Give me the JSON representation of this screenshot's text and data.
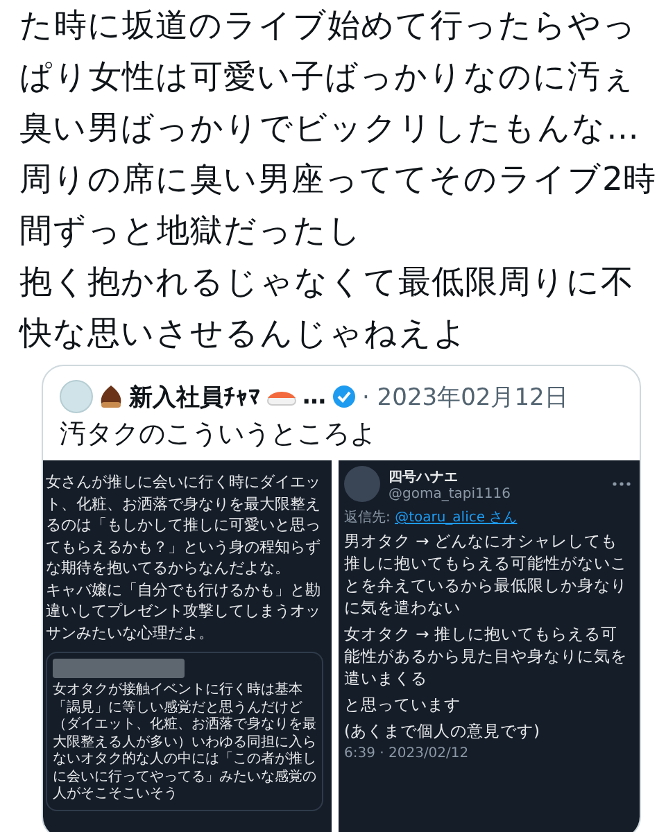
{
  "tweet": {
    "lines": [
      "た時に坂道のライブ始めて行ったらやっ",
      "ぱり女性は可愛い子ばっかりなのに汚ぇ",
      "臭い男ばっかりでビックリしたもんな…",
      "周りの席に臭い男座っててそのライブ2時",
      "間ずっと地獄だったし",
      "抱く抱かれるじゃなくて最低限周りに不",
      "快な思いさせるんじゃねえよ"
    ]
  },
  "quote": {
    "author": {
      "name": "新入社員ﾁｬﾏ",
      "truncation": "…",
      "verified": true
    },
    "date": "· 2023年02月12日",
    "text": "汚タクのこういうところよ",
    "images": [
      {
        "kind": "thread",
        "paragraphs": [
          "女さんが推しに会いに行く時にダイエット、化粧、お洒落で身なりを最大限整えるのは「もしかして推しに可愛いと思ってもらえるかも？」という身の程知らずな期待を抱いてるからなんだよな。",
          "キャバ嬢に「自分でも行けるかも」と勘違いしてプレゼント攻撃してしまうオッサンみたいな心理だよ。"
        ],
        "embedded": {
          "text": "女オタクが接触イベントに行く時は基本「謁見」に等しい感覚だと思うんだけど（ダイエット、化粧、お洒落で身なりを最大限整える人が多い）いわゆる同担に入らないオタク的な人の中には「この者が推しに会いに行ってやってる」みたいな感覚の人がそこそこいそう"
        }
      },
      {
        "kind": "reply",
        "author": {
          "name": "四号ハナエ",
          "handle": "@goma_tapi1116"
        },
        "reply_to": {
          "label": "返信先:",
          "user": "@toaru_alice さん"
        },
        "paragraphs": [
          "男オタク → どんなにオシャレしても推しに抱いてもらえる可能性がないことを弁えているから最低限しか身なりに気を遣わない",
          "女オタク → 推しに抱いてもらえる可能性があるから見た目や身なりに気を遣いまくる",
          "と思っています",
          "(あくまで個人の意見です)"
        ],
        "timestamp": "6:39 · 2023/02/12"
      }
    ]
  }
}
